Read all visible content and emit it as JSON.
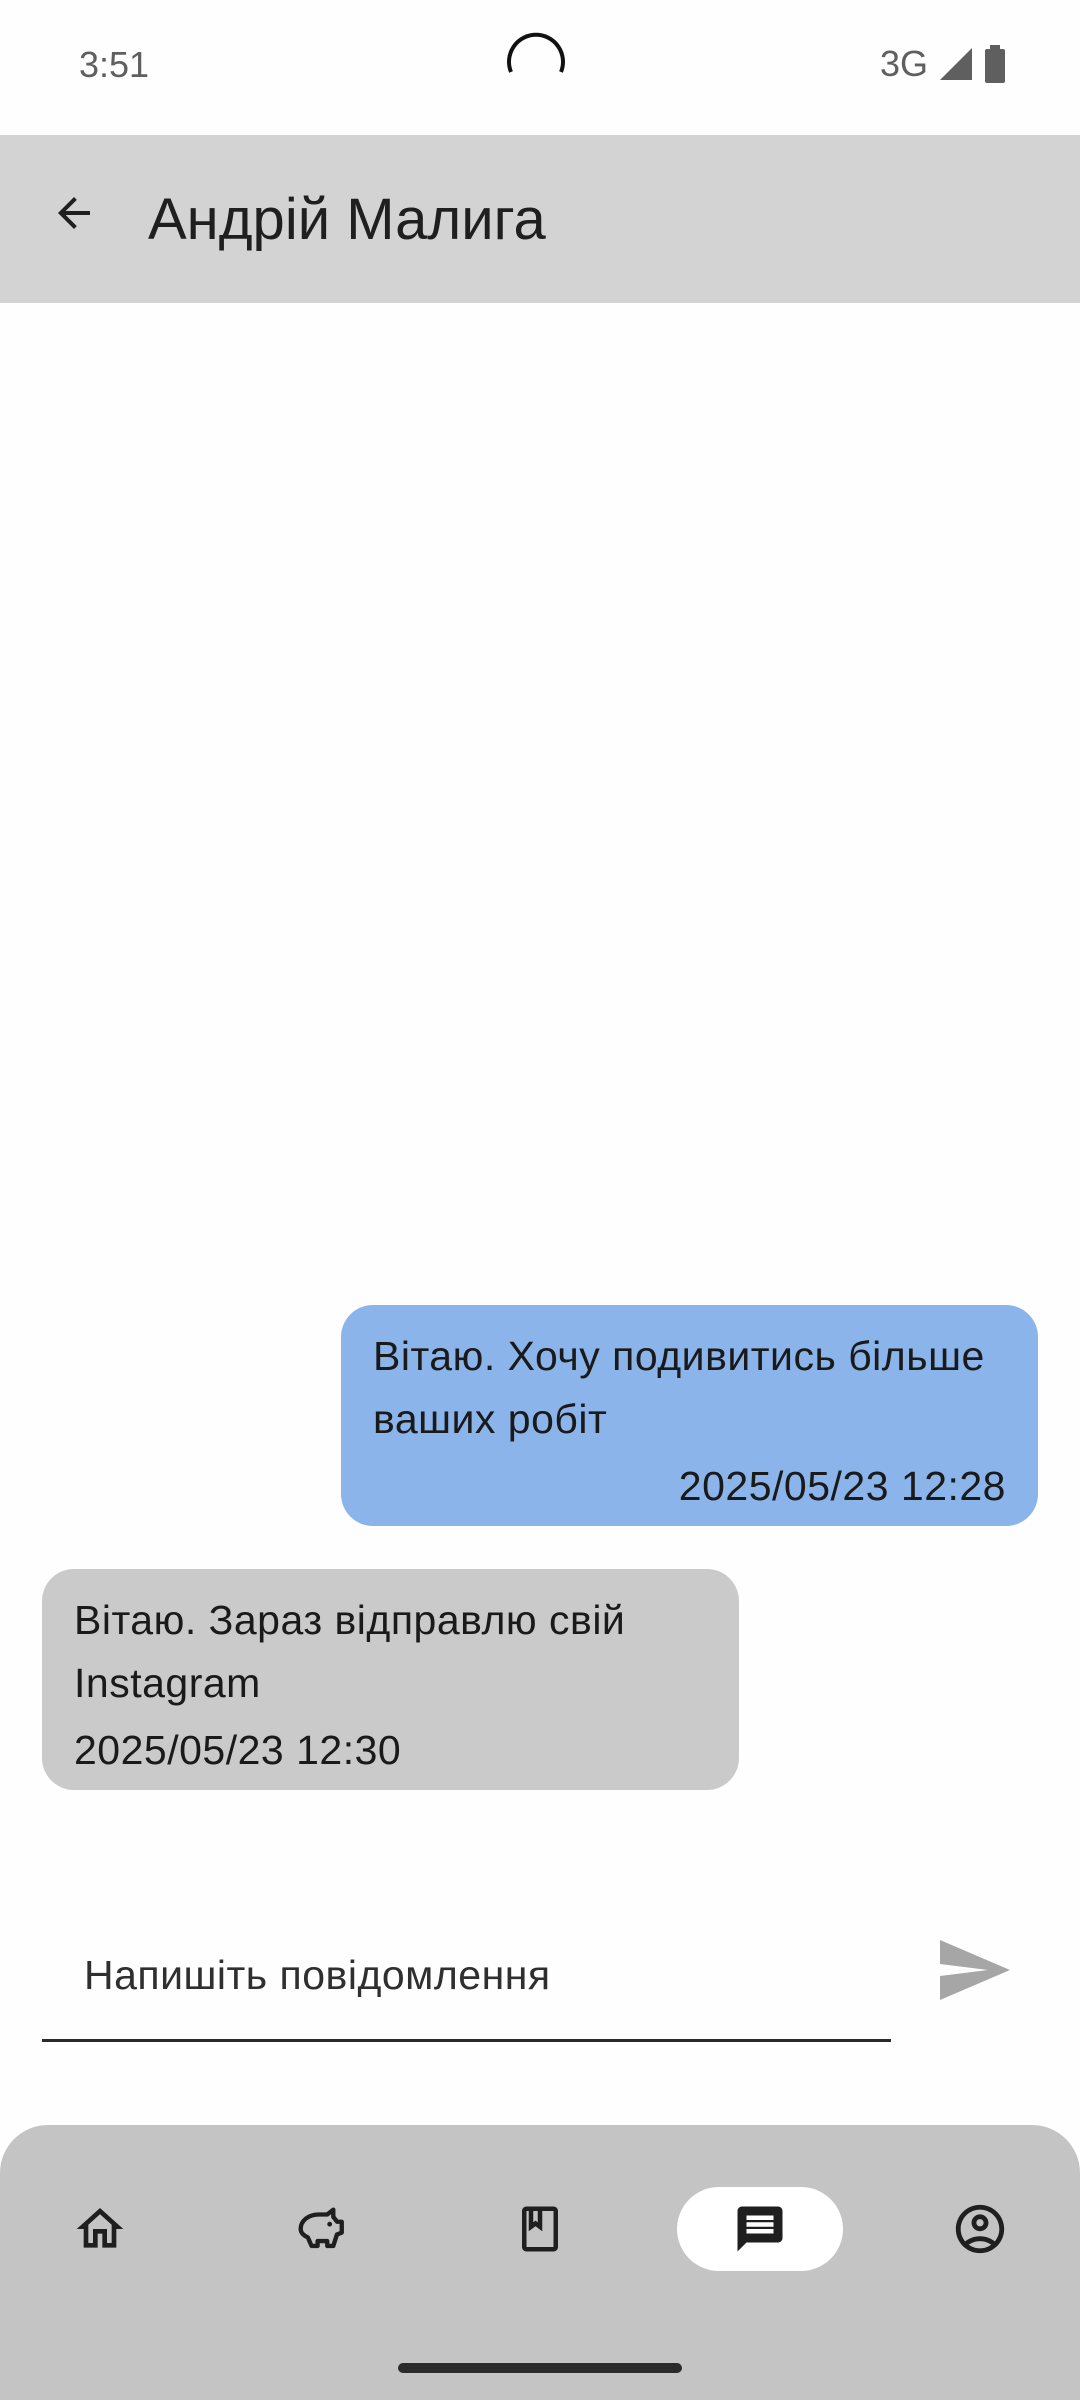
{
  "status_bar": {
    "time": "3:51",
    "network": "3G",
    "icons": [
      "signal-icon",
      "battery-icon"
    ]
  },
  "app_bar": {
    "back_icon": "arrow-back-icon",
    "title": "Андрій Малига"
  },
  "messages": [
    {
      "direction": "sent",
      "text": "Вітаю. Хочу подивитись більше ваших робіт",
      "time": "2025/05/23 12:28",
      "color": "#8ab4ea"
    },
    {
      "direction": "received",
      "text": "Вітаю. Зараз відправлю свій Instagram",
      "time": "2025/05/23 12:30",
      "color": "#cacaca"
    }
  ],
  "composer": {
    "placeholder": "Напишіть повідомлення",
    "value": "",
    "send_icon": "send-icon"
  },
  "bottom_nav": {
    "items": [
      {
        "icon": "home-icon",
        "active": false
      },
      {
        "icon": "piggy-bank-icon",
        "active": false
      },
      {
        "icon": "bookmark-book-icon",
        "active": false
      },
      {
        "icon": "chat-icon",
        "active": true
      },
      {
        "icon": "account-circle-icon",
        "active": false
      }
    ]
  },
  "colors": {
    "app_bar": "#d3d3d3",
    "sent_bubble": "#8ab4ea",
    "received_bubble": "#cacaca",
    "bottom_nav": "#c4c4c4",
    "background": "#fefefe"
  }
}
